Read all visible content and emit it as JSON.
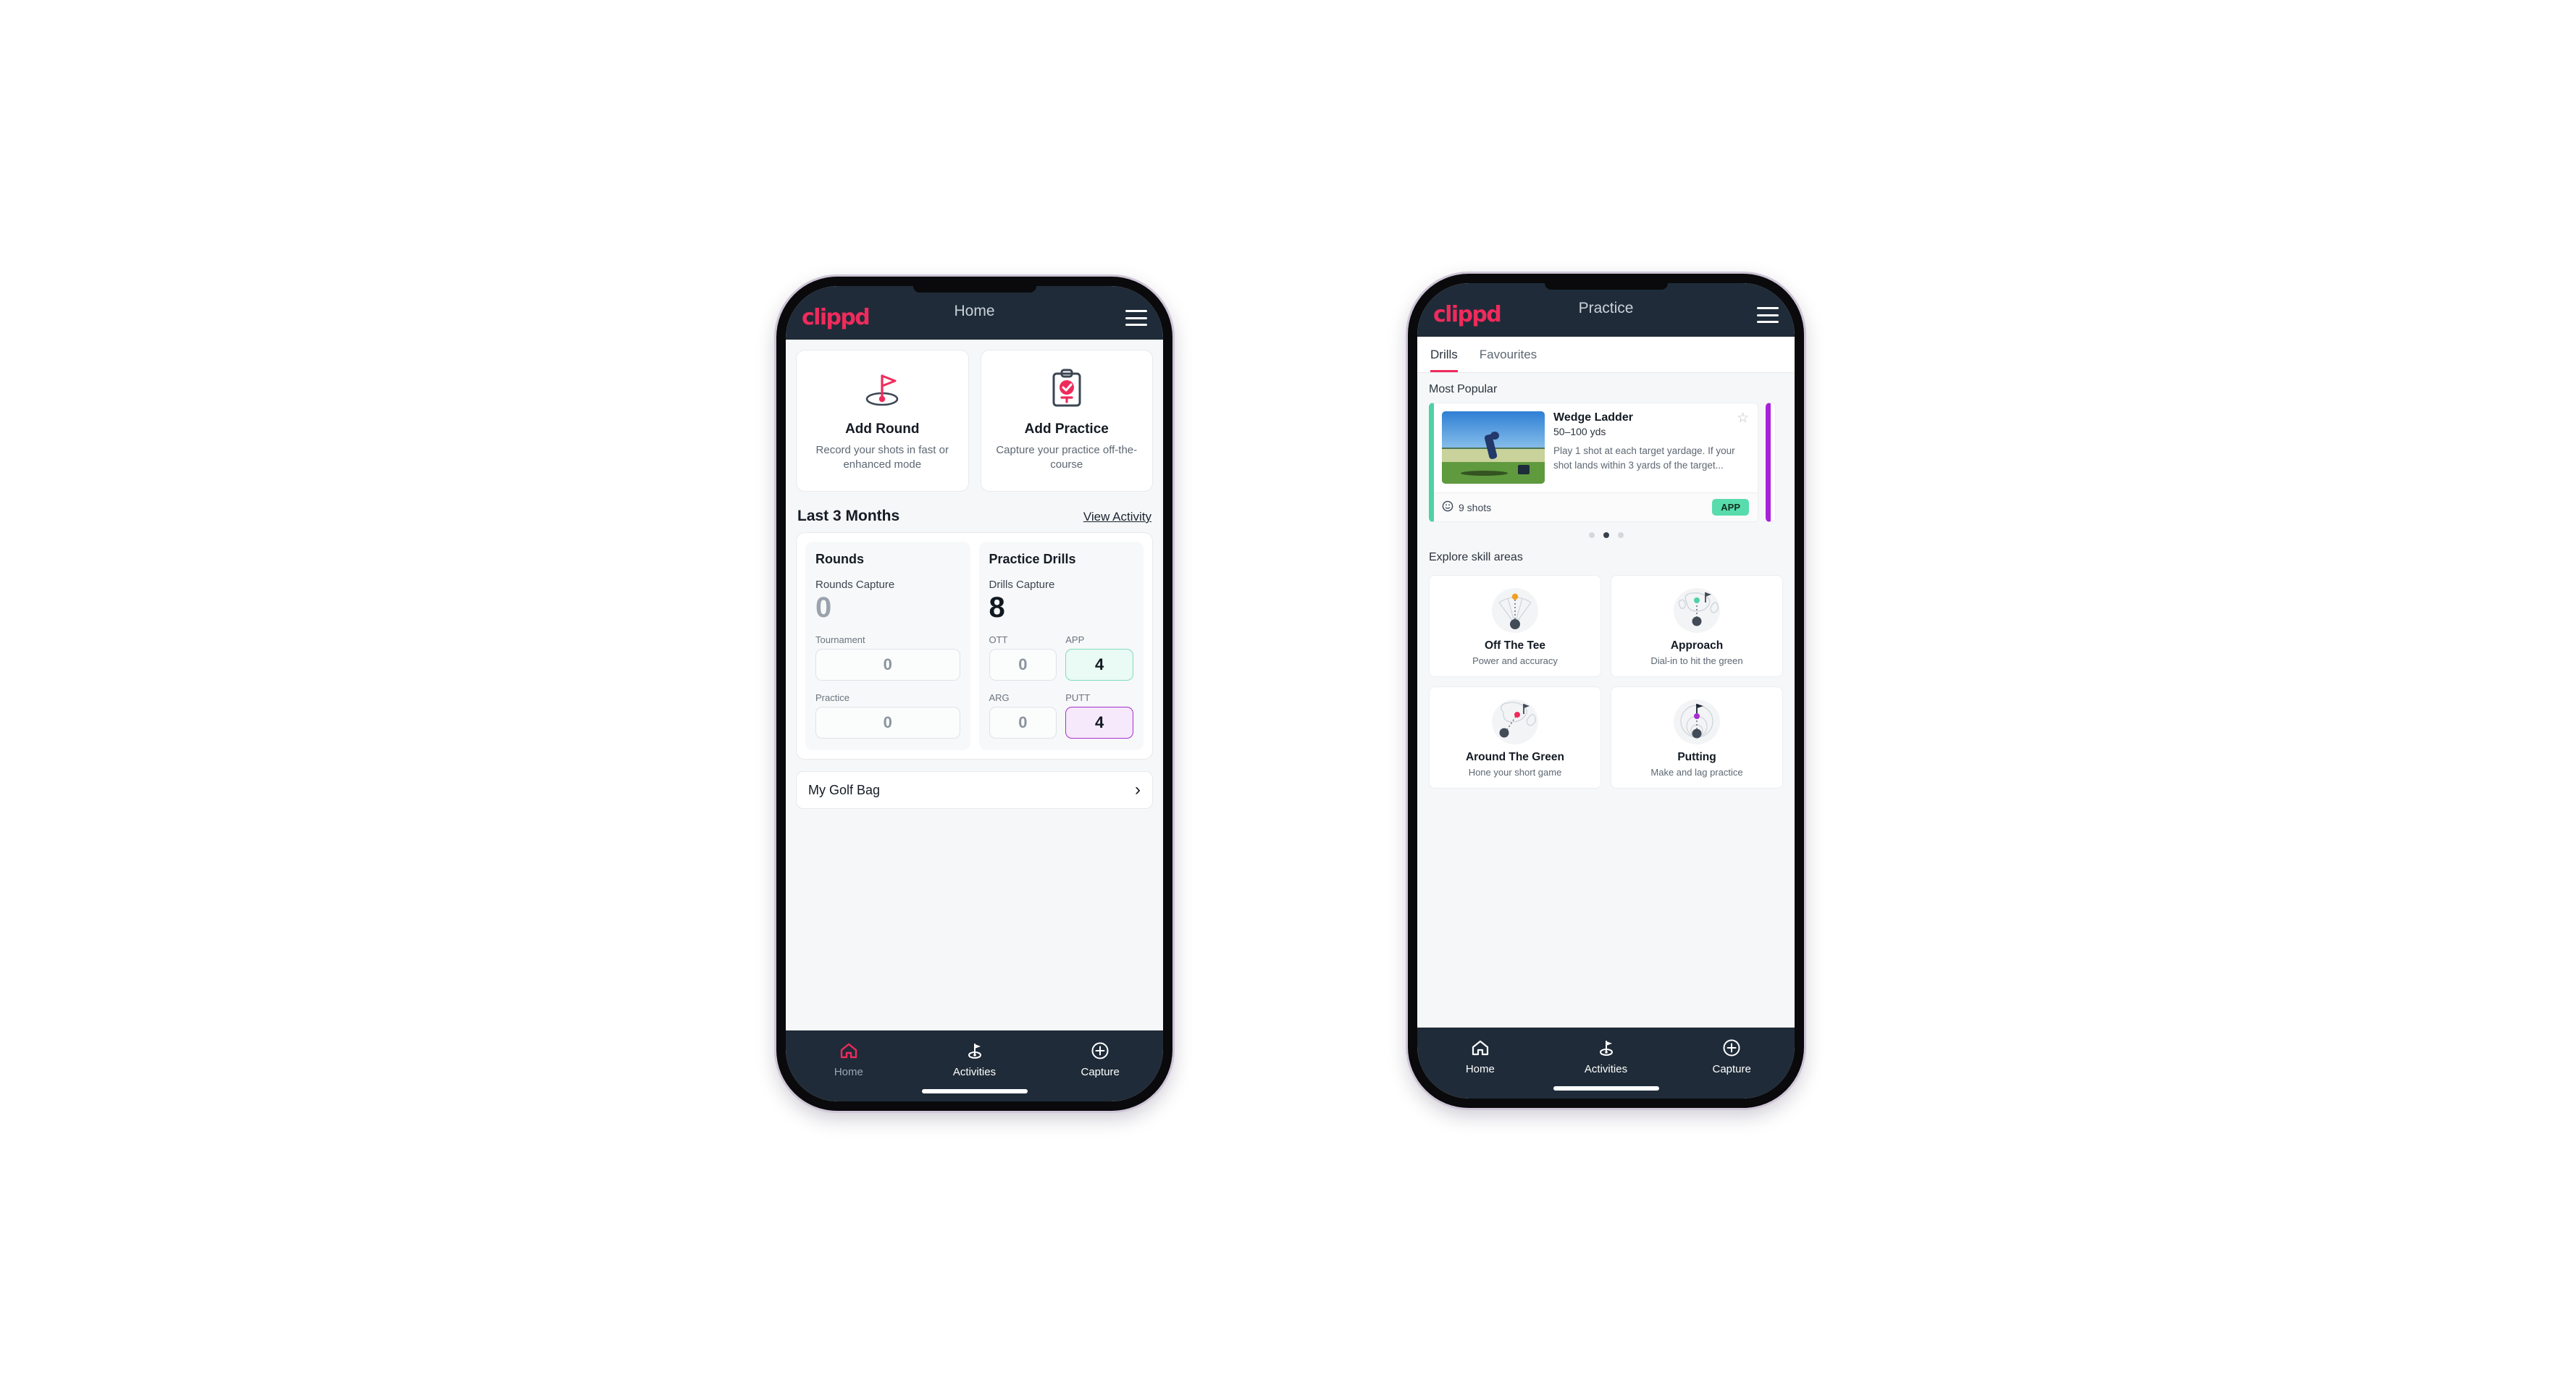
{
  "brand": {
    "name": "clippd",
    "accent": "#ef2b5c",
    "bar": "#1f2b38"
  },
  "home": {
    "appbar": {
      "title": "Home",
      "logo": "clippd",
      "menu_icon": "hamburger-icon"
    },
    "actions": [
      {
        "icon": "golf-flag-hole-icon",
        "title": "Add Round",
        "subtitle": "Record your shots in fast or enhanced mode"
      },
      {
        "icon": "clipboard-check-tee-icon",
        "title": "Add Practice",
        "subtitle": "Capture your practice off-the-course"
      }
    ],
    "section": {
      "title": "Last 3 Months",
      "link": "View Activity"
    },
    "rounds": {
      "heading": "Rounds",
      "capture_label": "Rounds Capture",
      "capture_value": "0",
      "fields": [
        {
          "label": "Tournament",
          "value": "0",
          "state": "empty"
        },
        {
          "label": "Practice",
          "value": "0",
          "state": "empty"
        }
      ]
    },
    "drills": {
      "heading": "Practice Drills",
      "capture_label": "Drills Capture",
      "capture_value": "8",
      "fields": [
        {
          "label": "OTT",
          "value": "0",
          "state": "empty"
        },
        {
          "label": "APP",
          "value": "4",
          "state": "green"
        },
        {
          "label": "ARG",
          "value": "0",
          "state": "empty"
        },
        {
          "label": "PUTT",
          "value": "4",
          "state": "purple"
        }
      ]
    },
    "golf_bag": {
      "label": "My Golf Bag",
      "chevron": "chevron-right-icon"
    },
    "nav": [
      {
        "label": "Home",
        "icon": "home-icon",
        "active": true
      },
      {
        "label": "Activities",
        "icon": "golf-flag-icon",
        "active": false
      },
      {
        "label": "Capture",
        "icon": "plus-circle-icon",
        "active": false
      }
    ]
  },
  "practice": {
    "appbar": {
      "title": "Practice",
      "logo": "clippd",
      "menu_icon": "hamburger-icon"
    },
    "tabs": [
      {
        "label": "Drills",
        "active": true
      },
      {
        "label": "Favourites",
        "active": false
      }
    ],
    "most_popular_label": "Most Popular",
    "drill": {
      "title": "Wedge Ladder",
      "yardage": "50–100 yds",
      "description": "Play 1 shot at each target yardage. If your shot lands within 3 yards of the target...",
      "shots": "9 shots",
      "shots_icon": "clock-icon",
      "badge": "APP",
      "badge_color": "#59dcad",
      "accent_color": "#4fd1a5",
      "next_accent_color": "#aa22d8",
      "favourite_icon": "star-outline-icon"
    },
    "carousel_dots": {
      "count": 3,
      "active_index": 1
    },
    "explore_label": "Explore skill areas",
    "skills": [
      {
        "icon": "tee-fan-icon",
        "name": "Off The Tee",
        "sub": "Power and accuracy",
        "dot_color": "#f2a020"
      },
      {
        "icon": "green-target-icon",
        "name": "Approach",
        "sub": "Dial-in to hit the green",
        "dot_color": "#4fd1a5"
      },
      {
        "icon": "chip-green-icon",
        "name": "Around The Green",
        "sub": "Hone your short game",
        "dot_color": "#ef2b5c"
      },
      {
        "icon": "putt-rings-icon",
        "name": "Putting",
        "sub": "Make and lag practice",
        "dot_color": "#a62fd0"
      }
    ],
    "nav": [
      {
        "label": "Home",
        "icon": "home-icon",
        "active": false
      },
      {
        "label": "Activities",
        "icon": "golf-flag-icon",
        "active": false
      },
      {
        "label": "Capture",
        "icon": "plus-circle-icon",
        "active": false
      }
    ]
  }
}
